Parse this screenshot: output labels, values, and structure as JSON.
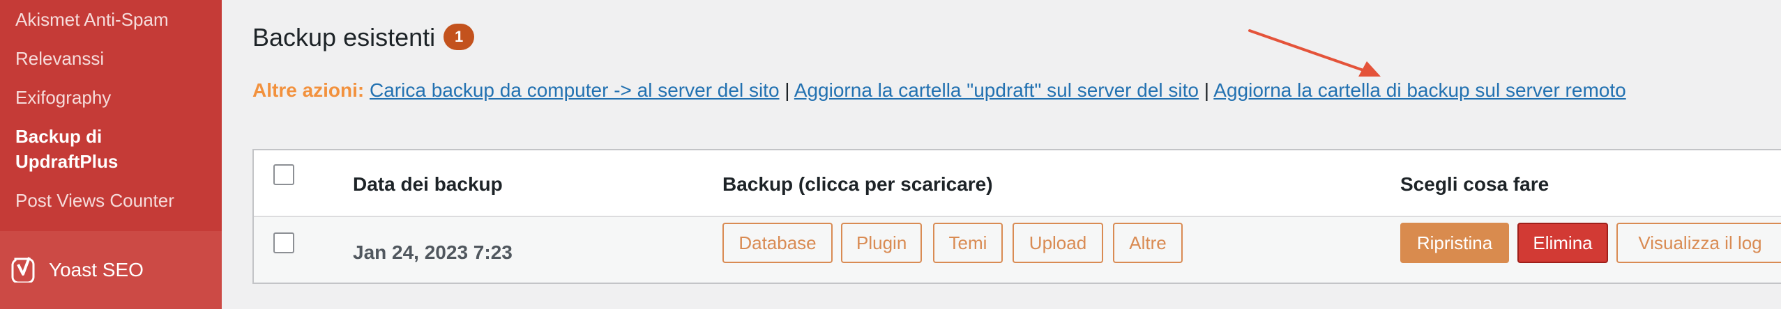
{
  "sidebar": {
    "items": [
      {
        "label": "Akismet Anti-Spam"
      },
      {
        "label": "Relevanssi"
      },
      {
        "label": "Exifography"
      },
      {
        "label": "Backup di\nUpdraftPlus",
        "line1": "Backup di",
        "line2": "UpdraftPlus",
        "current": true
      },
      {
        "label": "Post Views Counter"
      }
    ],
    "yoast": {
      "label": "Yoast SEO",
      "icon": "yoast-icon"
    }
  },
  "main": {
    "title": "Backup esistenti",
    "count": "1",
    "actions": {
      "label": "Altre azioni:",
      "links": [
        "Carica backup da computer -> al server del sito",
        "Aggiorna la cartella \"updraft\" sul server del sito",
        "Aggiorna la cartella di backup sul server remoto"
      ],
      "separator": "|"
    },
    "table": {
      "headers": [
        "Data dei backup",
        "Backup (clicca per scaricare)",
        "Scegli cosa fare"
      ],
      "rows": [
        {
          "date": "Jan 24, 2023 7:23",
          "downloads": [
            "Database",
            "Plugin",
            "Temi",
            "Upload",
            "Altre"
          ],
          "actions": [
            "Ripristina",
            "Elimina",
            "Visualizza il log"
          ]
        }
      ]
    }
  },
  "colors": {
    "sidebar_bg": "#c53b37",
    "accent_orange": "#d98b53",
    "link_blue": "#2271b1",
    "delete_red": "#d23a34",
    "annotation_arrow": "#e4533a"
  }
}
